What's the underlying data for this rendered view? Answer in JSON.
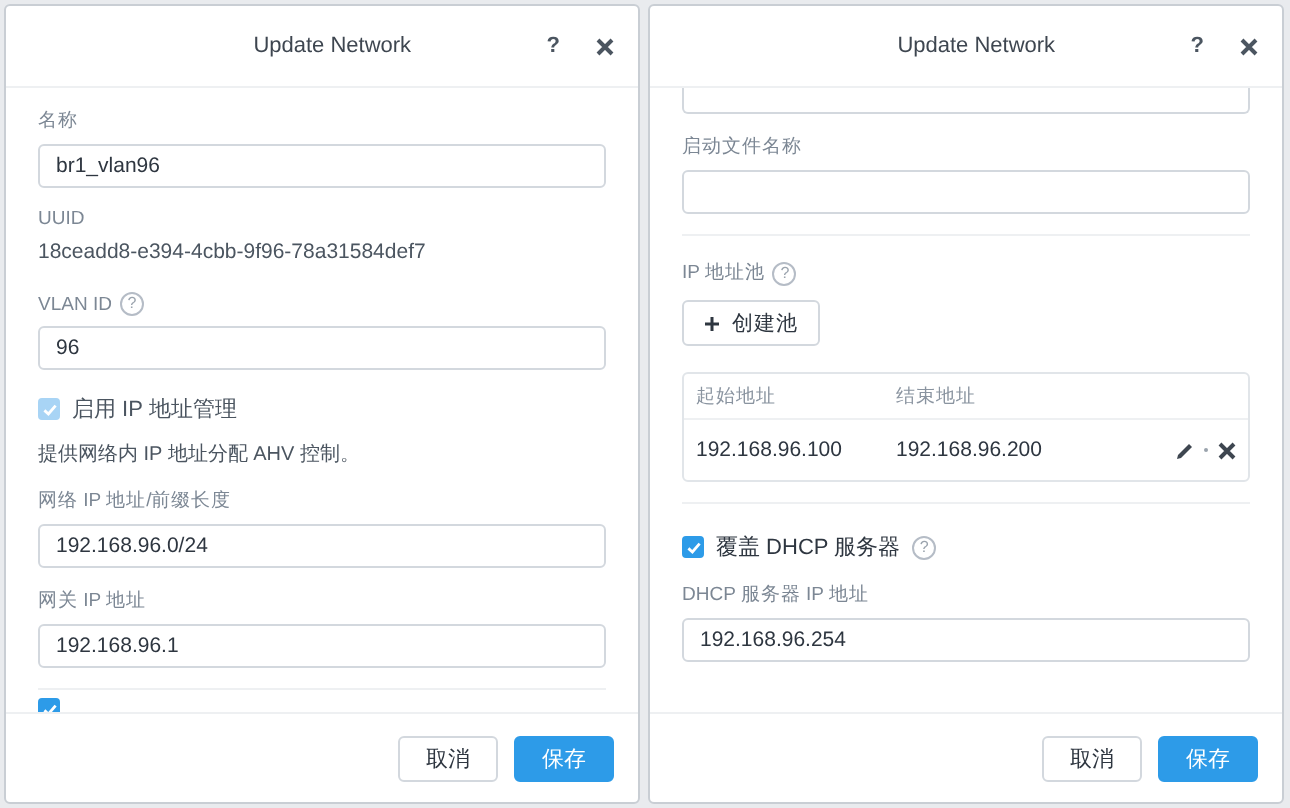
{
  "dialogs": [
    {
      "title": "Update Network",
      "help": "?",
      "items": [
        {
          "kind": "field",
          "label": "名称",
          "value": "br1_vlan96"
        },
        {
          "kind": "info",
          "label": "UUID",
          "value": "18ceadd8-e394-4cbb-9f96-78a31584def7"
        },
        {
          "kind": "field",
          "label": "VLAN ID",
          "help": "?",
          "value": "96"
        },
        {
          "kind": "checkbox",
          "label": "启用 IP 地址管理",
          "checked": true,
          "disabled": true
        },
        {
          "kind": "note",
          "text": "提供网络内 IP 地址分配 AHV 控制。"
        },
        {
          "kind": "field",
          "label": "网络 IP 地址/前缀长度",
          "value": "192.168.96.0/24"
        },
        {
          "kind": "field",
          "label": "网关 IP 地址",
          "value": "192.168.96.1"
        },
        {
          "kind": "divider"
        },
        {
          "kind": "clipped-checkbox",
          "checked": true
        }
      ],
      "buttons": [
        {
          "label": "取消",
          "kind": "secondary"
        },
        {
          "label": "保存",
          "kind": "primary"
        }
      ]
    },
    {
      "title": "Update Network",
      "help": "?",
      "items": [
        {
          "kind": "clipped-field"
        },
        {
          "kind": "field",
          "label": "启动文件名称"
        },
        {
          "kind": "divider"
        },
        {
          "kind": "pool",
          "label": "IP 地址池",
          "help": "?",
          "button": "创建池",
          "columns": [
            "起始地址",
            "结束地址"
          ],
          "rows": [
            [
              "192.168.96.100",
              "192.168.96.200"
            ]
          ]
        },
        {
          "kind": "divider"
        },
        {
          "kind": "checkbox",
          "label": "覆盖 DHCP 服务器",
          "help": "?",
          "checked": true,
          "disabled": false
        },
        {
          "kind": "field",
          "label": "DHCP 服务器 IP 地址",
          "value": "192.168.96.254"
        }
      ],
      "buttons": [
        {
          "label": "取消",
          "kind": "secondary"
        },
        {
          "label": "保存",
          "kind": "primary"
        }
      ]
    }
  ]
}
